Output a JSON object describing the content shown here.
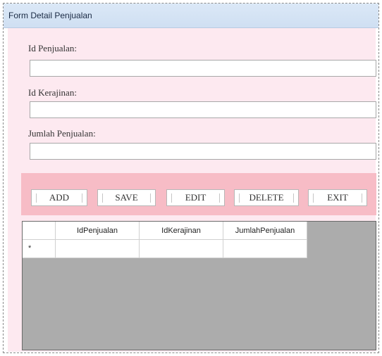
{
  "window": {
    "title": "Form Detail Penjualan"
  },
  "fields": {
    "id_penjualan_label": "Id Penjualan:",
    "id_penjualan_value": "",
    "id_kerajinan_label": "Id Kerajinan:",
    "id_kerajinan_value": "",
    "jumlah_penjualan_label": "Jumlah Penjualan:",
    "jumlah_penjualan_value": ""
  },
  "buttons": {
    "add": "ADD",
    "save": "SAVE",
    "edit": "EDIT",
    "delete": "DELETE",
    "exit": "EXIT"
  },
  "grid": {
    "columns": [
      "IdPenjualan",
      "IdKerajinan",
      "JumlahPenjualan"
    ],
    "new_row_marker": "*",
    "rows": []
  },
  "colors": {
    "form_background": "#fde9f0",
    "button_bar": "#f7bcc6",
    "grid_background": "#acacac",
    "titlebar": "#dbe8f7"
  }
}
